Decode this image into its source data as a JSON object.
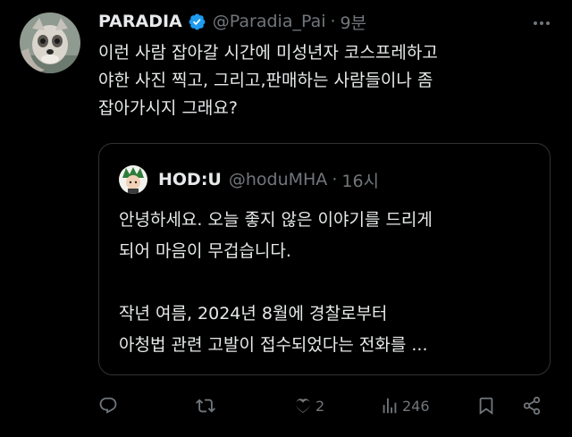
{
  "tweet": {
    "display_name": "PARADIA",
    "handle": "@Paradia_Pai",
    "separator": "·",
    "time": "9분",
    "text": "이런 사람 잡아갈 시간에 미성년자 코스프레하고\n야한 사진 찍고, 그리고,판매하는 사람들이나 좀\n잡아가시지 그래요?",
    "avatar_icon": "furry-avatar-icon",
    "verified_icon": "verified-badge-icon",
    "verified_color": "#1d9bf0"
  },
  "quote": {
    "display_name": "HOD:U",
    "handle": "@hoduMHA",
    "separator": "·",
    "time": "16시",
    "text": "안녕하세요. 오늘 좋지 않은 이야기를 드리게\n되어 마음이 무겁습니다.\n\n작년 여름, 2024년 8월에 경찰로부터\n아청법 관련 고발이 접수되었다는 전화를 ..."
  },
  "actions": {
    "reply_icon": "reply-icon",
    "retweet_icon": "retweet-icon",
    "like_icon": "heart-icon",
    "like_count": "2",
    "views_icon": "views-icon",
    "views_count": "246",
    "bookmark_icon": "bookmark-icon",
    "share_icon": "share-icon"
  },
  "colors": {
    "background": "#000000",
    "text_primary": "#e7e9ea",
    "text_secondary": "#71767b",
    "border": "#2f3336"
  }
}
